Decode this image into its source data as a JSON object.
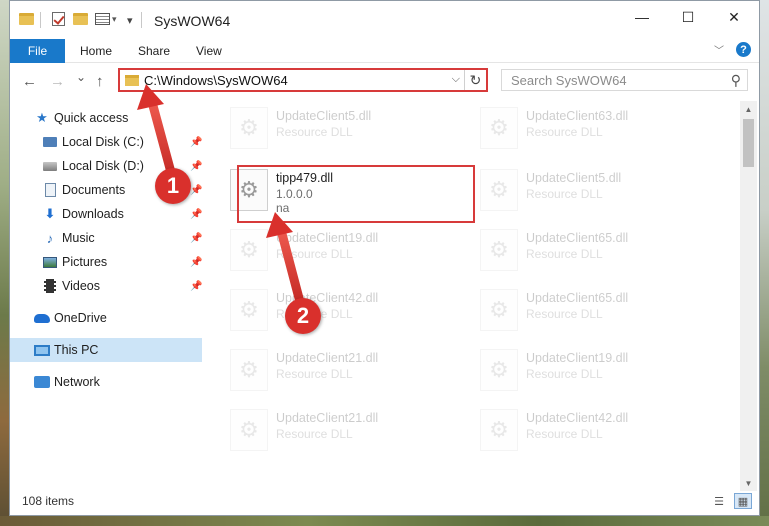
{
  "window": {
    "title": "SysWOW64",
    "minimize_glyph": "—",
    "maximize_glyph": "☐",
    "close_glyph": "✕"
  },
  "quick_access_toolbar": {
    "icons": [
      "folder-icon",
      "properties-check-icon",
      "new-folder-icon",
      "properties-icon",
      "customize-dropdown-icon"
    ],
    "dropdown_glyph": "▾"
  },
  "ribbon": {
    "tabs": [
      {
        "label": "File",
        "active": true
      },
      {
        "label": "Home"
      },
      {
        "label": "Share"
      },
      {
        "label": "View"
      }
    ],
    "expand_glyph": "﹀",
    "help_glyph": "?"
  },
  "navigation": {
    "back_glyph": "←",
    "forward_glyph": "→",
    "recent_glyph": "⌄",
    "up_glyph": "↑",
    "address": "C:\\Windows\\SysWOW64",
    "address_dropdown_glyph": "⌵",
    "refresh_glyph": "↻",
    "search_placeholder": "Search SysWOW64",
    "search_glyph": "⚲"
  },
  "sidebar": {
    "items": [
      {
        "label": "Quick access",
        "icon": "star-icon",
        "pinned": false
      },
      {
        "label": "Local Disk (C:)",
        "icon": "local-disk-c-icon",
        "pinned": true
      },
      {
        "label": "Local Disk (D:)",
        "icon": "local-disk-d-icon",
        "pinned": true
      },
      {
        "label": "Documents",
        "icon": "documents-icon",
        "pinned": true
      },
      {
        "label": "Downloads",
        "icon": "downloads-icon",
        "pinned": true
      },
      {
        "label": "Music",
        "icon": "music-icon",
        "pinned": true
      },
      {
        "label": "Pictures",
        "icon": "pictures-icon",
        "pinned": true
      },
      {
        "label": "Videos",
        "icon": "videos-icon",
        "pinned": true
      },
      {
        "label": "OneDrive",
        "icon": "onedrive-icon",
        "pinned": false
      },
      {
        "label": "This PC",
        "icon": "this-pc-icon",
        "pinned": false,
        "selected": true
      },
      {
        "label": "Network",
        "icon": "network-icon",
        "pinned": false
      }
    ],
    "pin_glyph": "📌"
  },
  "files": {
    "left_column": [
      {
        "name": "UpdateClient5.dll",
        "type": "Resource DLL",
        "faded": true
      },
      {
        "name": "tipp479.dll",
        "version": "1.0.0.0",
        "company": "na",
        "faded": false
      },
      {
        "name": "UpdateClient19.dll",
        "type": "Resource DLL",
        "faded": true
      },
      {
        "name": "UpdateClient42.dll",
        "type": "Resource DLL",
        "faded": true
      },
      {
        "name": "UpdateClient21.dll",
        "type": "Resource DLL",
        "faded": true
      },
      {
        "name": "UpdateClient21.dll",
        "type": "Resource DLL",
        "faded": true
      }
    ],
    "right_column": [
      {
        "name": "UpdateClient63.dll",
        "type": "Resource DLL",
        "faded": true
      },
      {
        "name": "UpdateClient5.dll",
        "type": "Resource DLL",
        "faded": true
      },
      {
        "name": "UpdateClient65.dll",
        "type": "Resource DLL",
        "faded": true
      },
      {
        "name": "UpdateClient65.dll",
        "type": "Resource DLL",
        "faded": true
      },
      {
        "name": "UpdateClient19.dll",
        "type": "Resource DLL",
        "faded": true
      },
      {
        "name": "UpdateClient42.dll",
        "type": "Resource DLL",
        "faded": true
      }
    ],
    "file_icon": "dll-gear-icon",
    "gear_glyph": "⚙"
  },
  "scrollbar": {
    "up_glyph": "▲",
    "down_glyph": "▼"
  },
  "status": {
    "item_count": "108 items",
    "details_view_glyph": "☰",
    "tiles_view_glyph": "▦"
  },
  "callouts": [
    {
      "label": "1"
    },
    {
      "label": "2"
    }
  ],
  "colors": {
    "accent": "#1979ca",
    "highlight_red": "#d73a3a",
    "callout_red": "#d9302c",
    "selected_bg": "#cce4f7"
  }
}
